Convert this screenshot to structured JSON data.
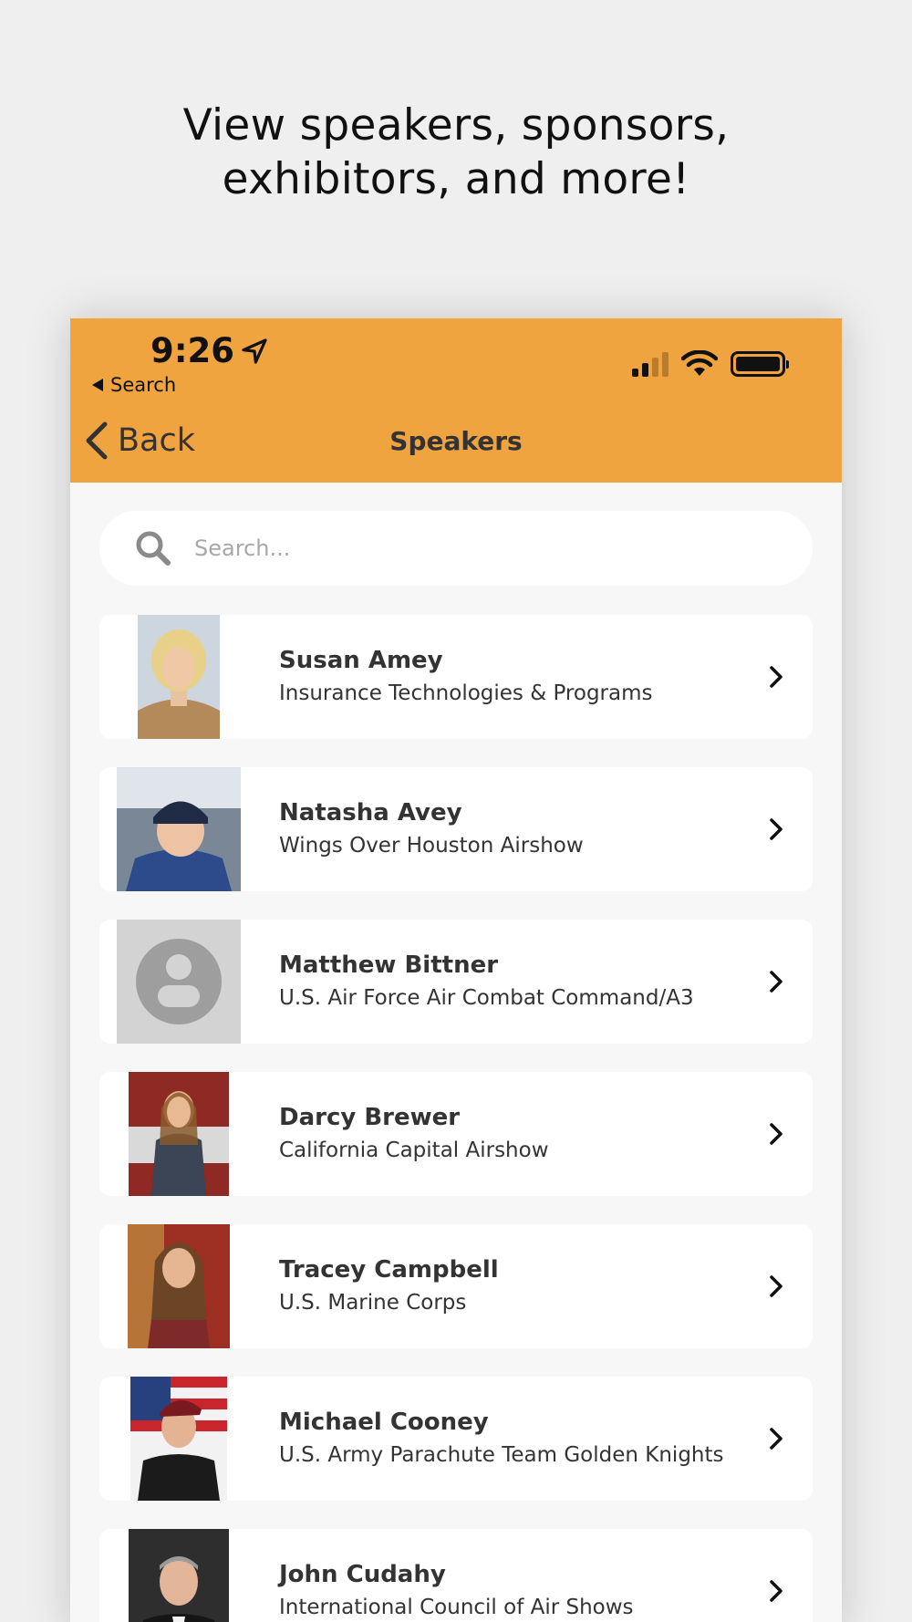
{
  "headline": {
    "line1": "View speakers, sponsors,",
    "line2": "exhibitors, and more!"
  },
  "status_bar": {
    "time": "9:26",
    "back_app": "Search"
  },
  "nav": {
    "back_label": "Back",
    "title": "Speakers"
  },
  "search": {
    "placeholder": "Search..."
  },
  "speakers": [
    {
      "name": "Susan  Amey",
      "org": "Insurance Technologies & Programs"
    },
    {
      "name": "Natasha Avey",
      "org": "Wings Over Houston Airshow"
    },
    {
      "name": "Matthew Bittner",
      "org": "U.S. Air Force Air Combat Command/A3"
    },
    {
      "name": "Darcy Brewer",
      "org": "California Capital Airshow"
    },
    {
      "name": "Tracey Campbell",
      "org": "U.S. Marine Corps"
    },
    {
      "name": "Michael Cooney",
      "org": "U.S. Army Parachute Team Golden Knights"
    },
    {
      "name": "John Cudahy",
      "org": "International Council of Air Shows"
    }
  ],
  "colors": {
    "accent": "#efa43f",
    "background": "#efefef",
    "card": "#ffffff"
  }
}
